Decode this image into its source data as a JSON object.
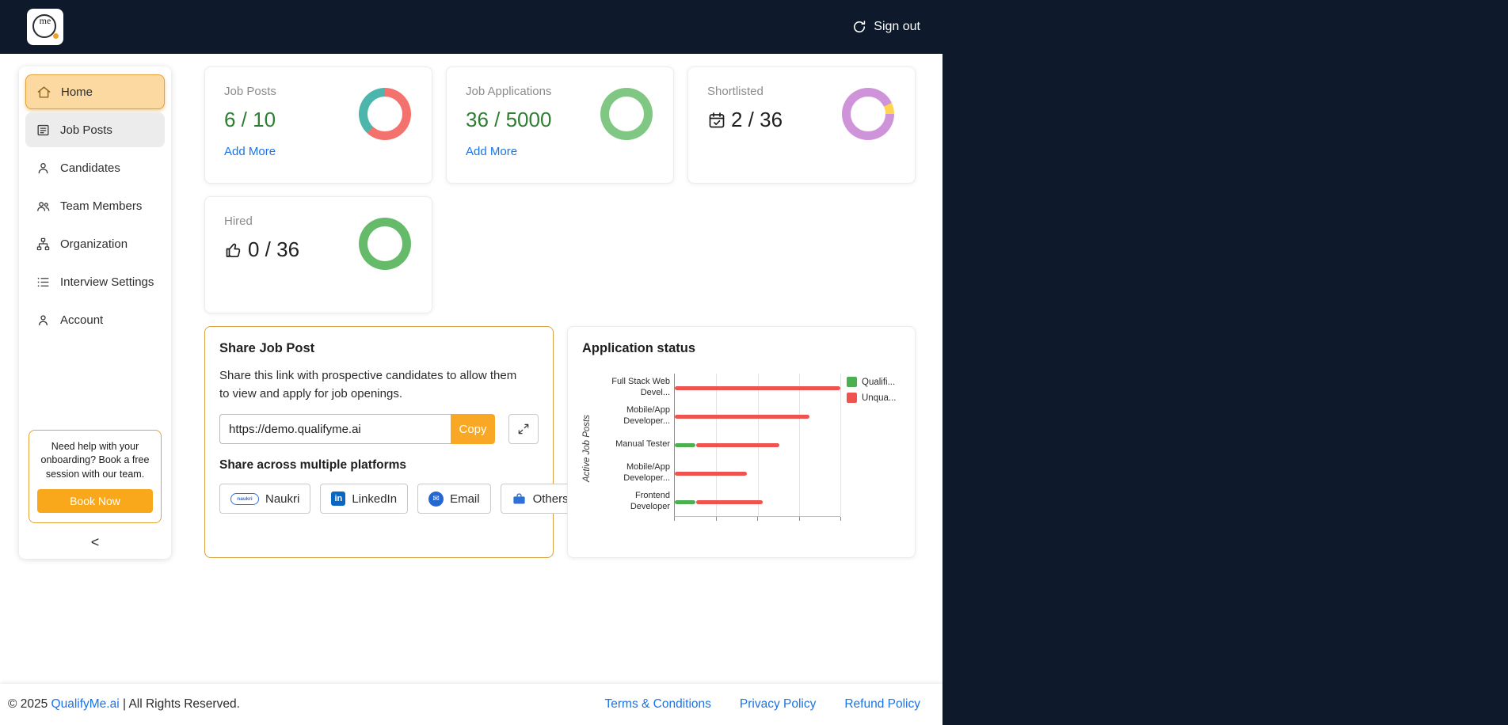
{
  "navbar": {
    "signout": "Sign out"
  },
  "sidebar": {
    "items": [
      {
        "label": "Home"
      },
      {
        "label": "Job Posts"
      },
      {
        "label": "Candidates"
      },
      {
        "label": "Team Members"
      },
      {
        "label": "Organization"
      },
      {
        "label": "Interview Settings"
      },
      {
        "label": "Account"
      }
    ],
    "help_text": "Need help with your onboarding? Book a free session with our team.",
    "book_now": "Book Now",
    "collapse": "<"
  },
  "stats": [
    {
      "title": "Job Posts",
      "value": "6 / 10",
      "link": "Add More",
      "ring": {
        "segments": [
          {
            "color": "#f4726d",
            "pct": 62
          },
          {
            "color": "#4db6ac",
            "pct": 38
          }
        ]
      }
    },
    {
      "title": "Job Applications",
      "value": "36 / 5000",
      "link": "Add More",
      "ring": {
        "segments": [
          {
            "color": "#81c784",
            "pct": 100
          }
        ]
      }
    },
    {
      "title": "Shortlisted",
      "value": "2 / 36",
      "ring": {
        "segments": [
          {
            "color": "#ce93d8",
            "pct": 18
          },
          {
            "color": "#ffd54f",
            "pct": 7
          },
          {
            "color": "#ce93d8",
            "pct": 75
          }
        ]
      }
    },
    {
      "title": "Hired",
      "value": "0 / 36",
      "ring": {
        "segments": [
          {
            "color": "#66bb6a",
            "pct": 100
          }
        ]
      }
    }
  ],
  "share": {
    "title": "Share Job Post",
    "description": "Share this link with prospective candidates to allow them to view and apply for job openings.",
    "url": "https://demo.qualifyme.ai",
    "copy_label": "Copy",
    "platforms_heading": "Share across multiple platforms",
    "platforms": [
      {
        "label": "Naukri"
      },
      {
        "label": "LinkedIn"
      },
      {
        "label": "Email"
      },
      {
        "label": "Others"
      }
    ],
    "linkedin_glyph": "in",
    "naukri_glyph": "naukri",
    "email_glyph": "✉"
  },
  "chart_data": {
    "type": "bar",
    "orientation": "horizontal",
    "title": "Application status",
    "ylabel": "Active Job Posts",
    "categories": [
      "Full Stack Web Devel...",
      "Mobile/App Developer...",
      "Manual Tester",
      "Mobile/App Developer...",
      "Frontend Developer"
    ],
    "series": [
      {
        "name": "Qualifi...",
        "color": "#4caf50",
        "values": [
          0,
          0,
          1,
          0,
          1
        ]
      },
      {
        "name": "Unqua...",
        "color": "#ef5350",
        "values": [
          8,
          6.5,
          4,
          3.5,
          3.2
        ]
      }
    ],
    "xlim": [
      0,
      8
    ],
    "xtick_step": 2,
    "grid": true,
    "legend_position": "right"
  },
  "footer": {
    "copyright_prefix": "© 2025 ",
    "brand": "QualifyMe.ai",
    "copyright_suffix": " | All Rights Reserved.",
    "links": [
      {
        "label": "Terms & Conditions"
      },
      {
        "label": "Privacy Policy"
      },
      {
        "label": "Refund Policy"
      }
    ]
  }
}
